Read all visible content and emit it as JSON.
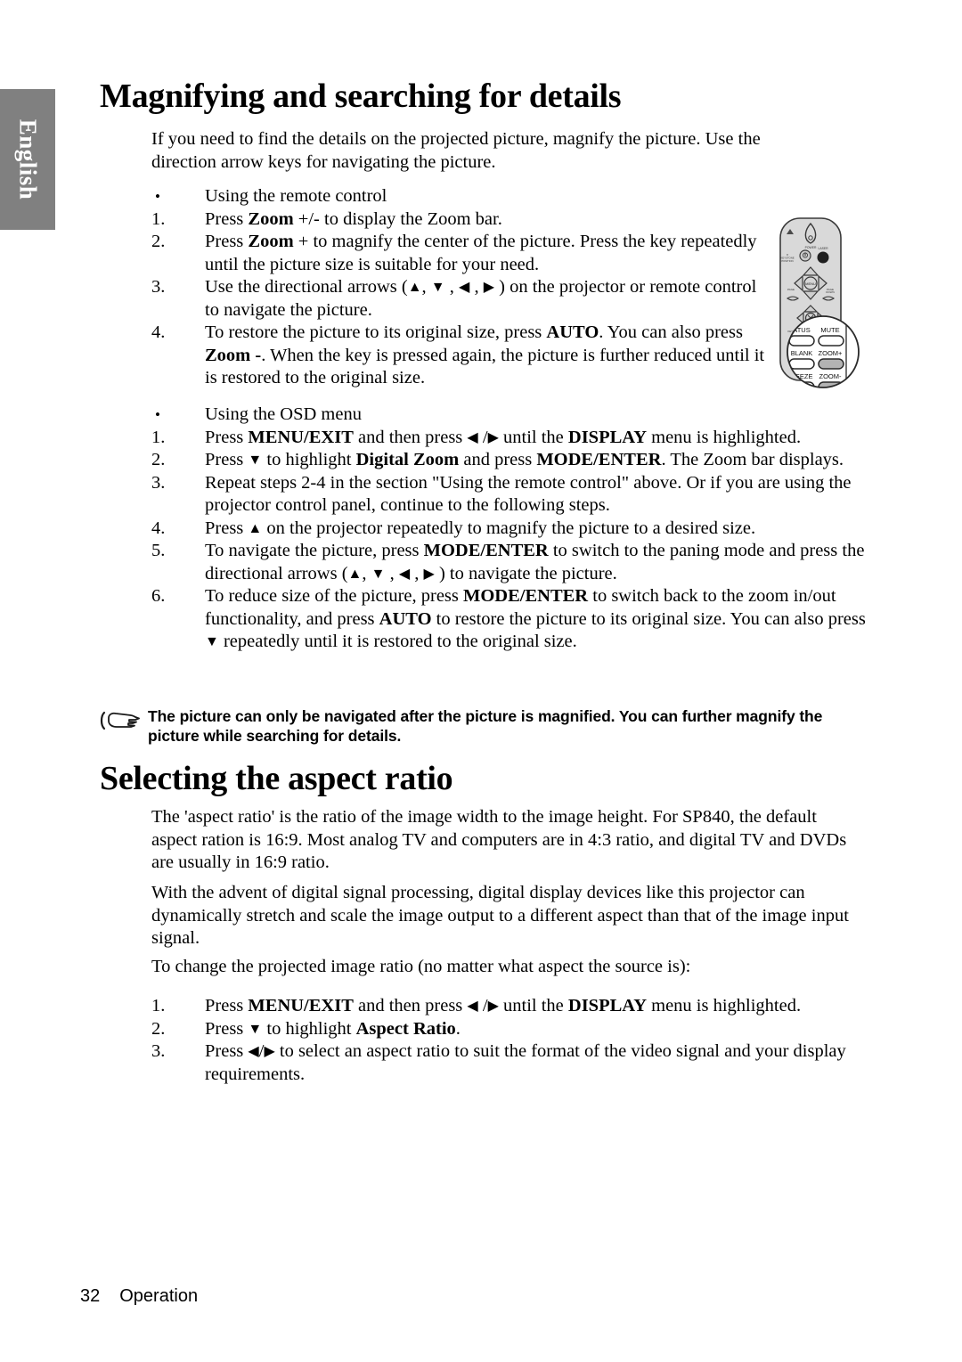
{
  "sidebar": {
    "language_tab": "English"
  },
  "sections": [
    {
      "title": "Magnifying and searching for details",
      "intro": "If you need to find the details on the projected picture, magnify the picture. Use the direction arrow keys for navigating the picture."
    },
    {
      "title": "Selecting the aspect ratio"
    }
  ],
  "magnify": {
    "title": "Magnifying and searching for details",
    "intro": "If you need to find the details on the projected picture, magnify the picture. Use the direction arrow keys for navigating the picture.",
    "remote_heading": "Using the remote control",
    "remote_bullet": "•",
    "remote_steps": [
      {
        "num": "1.",
        "text": "Press Zoom +/- to display the Zoom bar."
      },
      {
        "num": "2.",
        "text": "Press Zoom + to magnify the center of the picture. Press the key repeatedly until the picture size is suitable for your need."
      },
      {
        "num": "3.",
        "text": "Use the directional arrows ( ▲ , ▼ , ◀ , ▶ ) on the projector or remote control to navigate the picture."
      },
      {
        "num": "4.",
        "text": "To restore the picture to its original size, press AUTO. You can also press Zoom -. When the key is pressed again, the picture is further reduced until it is restored to the original size."
      }
    ],
    "osd_heading": "Using the OSD menu",
    "osd_bullet": "•",
    "osd_steps": [
      {
        "num": "1.",
        "text": "Press MENU/EXIT and then press ◀ / ▶ until the DISPLAY menu is highlighted."
      },
      {
        "num": "2.",
        "text": "Press ▼ to highlight Digital Zoom and press MODE/ENTER. The Zoom bar displays."
      },
      {
        "num": "3.",
        "text": "Repeat steps 2-4 in the section \"Using the remote control\" above. Or if you are using the projector control panel, continue to the following steps."
      },
      {
        "num": "4.",
        "text": "Press ▲ on the projector repeatedly to magnify the picture to a desired size."
      },
      {
        "num": "5.",
        "text": "To navigate the picture, press MODE/ENTER to switch to the paning mode and press the directional arrows ( ▲ , ▼ , ◀ , ▶ ) to navigate the picture."
      },
      {
        "num": "6.",
        "text": "To reduce size of the picture, press MODE/ENTER to switch back to the zoom in/out functionality, and press AUTO to restore the picture to its original size. You can also press ▼ repeatedly until it is restored to the original size."
      }
    ],
    "note": "The picture can only be navigated after the picture is magnified. You can further magnify the picture while searching for details."
  },
  "aspect": {
    "title": "Selecting the aspect ratio",
    "para1": "The 'aspect ratio' is the ratio of the image width to the image height. For SP840, the default aspect ration is 16:9. Most analog TV and computers are in 4:3 ratio, and digital TV and DVDs are usually in 16:9 ratio.",
    "para2": "With the advent of digital signal processing, digital display devices like this projector can dynamically stretch and scale the image output to a different aspect than that of the image input signal.",
    "para3": "To change the projected image ratio (no matter what aspect the source is):",
    "steps": [
      {
        "num": "1.",
        "text": "Press MENU/EXIT and then press ◀ / ▶ until the DISPLAY menu is highlighted."
      },
      {
        "num": "2.",
        "text": "Press ▼ to highlight Aspect Ratio."
      },
      {
        "num": "3.",
        "text": "Press ◀/▶ to select an aspect ratio to suit the format of the video signal and your display requirements."
      }
    ]
  },
  "remote_illustration": {
    "labels": {
      "power": "POWER",
      "laser": "LASER",
      "source": "SOURCE",
      "keystone_up": "KEYSTONE",
      "page_up": "PAGE",
      "menu": "MENU",
      "exit": "EXIT",
      "status": "ATUS",
      "mute": "MUTE",
      "blank": "BLANK",
      "zoom_in": "ZOOM+",
      "freeze": "FREEZE",
      "zoom_out": "ZOOM-"
    }
  },
  "footer": {
    "page_number": "32",
    "chapter": "Operation"
  },
  "colors": {
    "tab_background": "#808080",
    "tab_text": "#ffffff",
    "page_background": "#ffffff",
    "text": "#000000",
    "remote_body": "#d9d9d9",
    "remote_button": "#b3b3b3"
  }
}
